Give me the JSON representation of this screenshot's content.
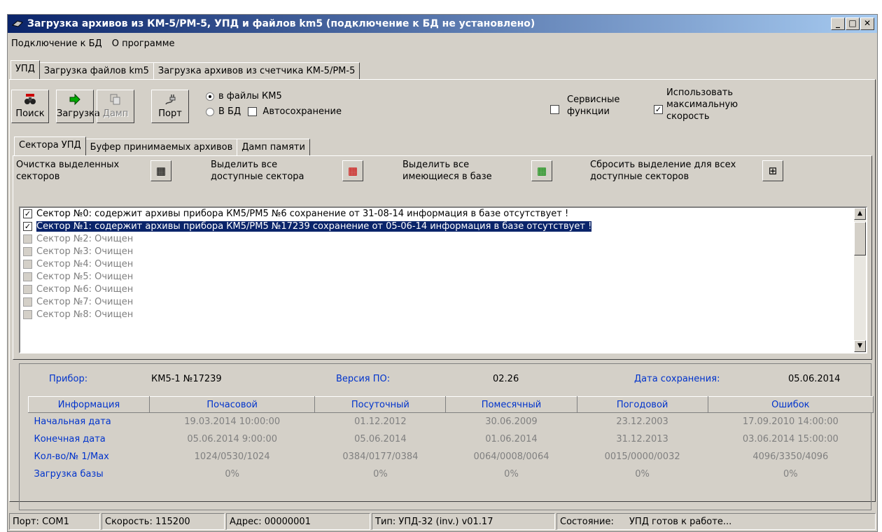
{
  "window": {
    "title": "Загрузка архивов из КМ-5/РМ-5, УПД и файлов km5 (подключение к БД не установлено)",
    "minimize": "_",
    "maximize": "□",
    "close": "✕"
  },
  "menu": [
    "Подключение к БД",
    "О программе"
  ],
  "main_tabs": [
    "УПД",
    "Загрузка файлов km5",
    "Загрузка архивов из счетчика КМ-5/РМ-5"
  ],
  "toolbar": {
    "search": "Поиск",
    "load": "Загрузка",
    "dump": "Дамп",
    "port": "Порт"
  },
  "options": {
    "to_files": "в файлы КМ5",
    "to_db": "В БД",
    "autosave": "Автосохранение",
    "service": "Сервисные функции",
    "max_speed": "Использовать максимальную скорость"
  },
  "sub_tabs": [
    "Сектора УПД",
    "Буфер принимаемых архивов",
    "Дамп памяти"
  ],
  "actions": {
    "clear": "Очистка выделенных секторов",
    "select_all": "Выделить все доступные сектора",
    "select_in_db": "Выделить все имеющиеся в базе",
    "reset": "Сбросить выделение для всех доступные секторов"
  },
  "sectors": [
    "Сектор №0: содержит архивы прибора КМ5/РМ5 №6 сохранение от 31-08-14 информация в базе отсутствует !",
    "Сектор №1: содержит архивы прибора КМ5/РМ5 №17239 сохранение от 05-06-14 информация в базе отсутствует !",
    "Сектор №2: Очищен",
    "Сектор №3: Очищен",
    "Сектор №4: Очищен",
    "Сектор №5: Очищен",
    "Сектор №6: Очищен",
    "Сектор №7: Очищен",
    "Сектор №8: Очищен"
  ],
  "device": {
    "label": "Прибор:",
    "value": "КМ5-1 №17239",
    "ver_label": "Версия ПО:",
    "ver": "02.26",
    "date_label": "Дата сохранения:",
    "date": "05.06.2014"
  },
  "table": {
    "headers": [
      "Информация",
      "Почасовой",
      "Посуточный",
      "Помесячный",
      "Погодовой",
      "Ошибок"
    ],
    "rows": [
      [
        "Начальная дата",
        "19.03.2014 10:00:00",
        "01.12.2012",
        "30.06.2009",
        "23.12.2003",
        "17.09.2010 14:00:00"
      ],
      [
        "Конечная дата",
        "05.06.2014 9:00:00",
        "05.06.2014",
        "01.06.2014",
        "31.12.2013",
        "03.06.2014 15:00:00"
      ],
      [
        "Кол-во/№ 1/Max",
        "1024/0530/1024",
        "0384/0177/0384",
        "0064/0008/0064",
        "0015/0000/0032",
        "4096/3350/4096"
      ],
      [
        "Загрузка базы",
        "0%",
        "0%",
        "0%",
        "0%",
        "0%"
      ]
    ]
  },
  "status": {
    "port": "Порт: COM1",
    "speed": "Скорость: 115200",
    "address": "Адрес: 00000001",
    "type": "Тип: УПД-32 (inv.) v01.17",
    "state_label": "Состояние:",
    "state": "УПД готов к работе..."
  }
}
